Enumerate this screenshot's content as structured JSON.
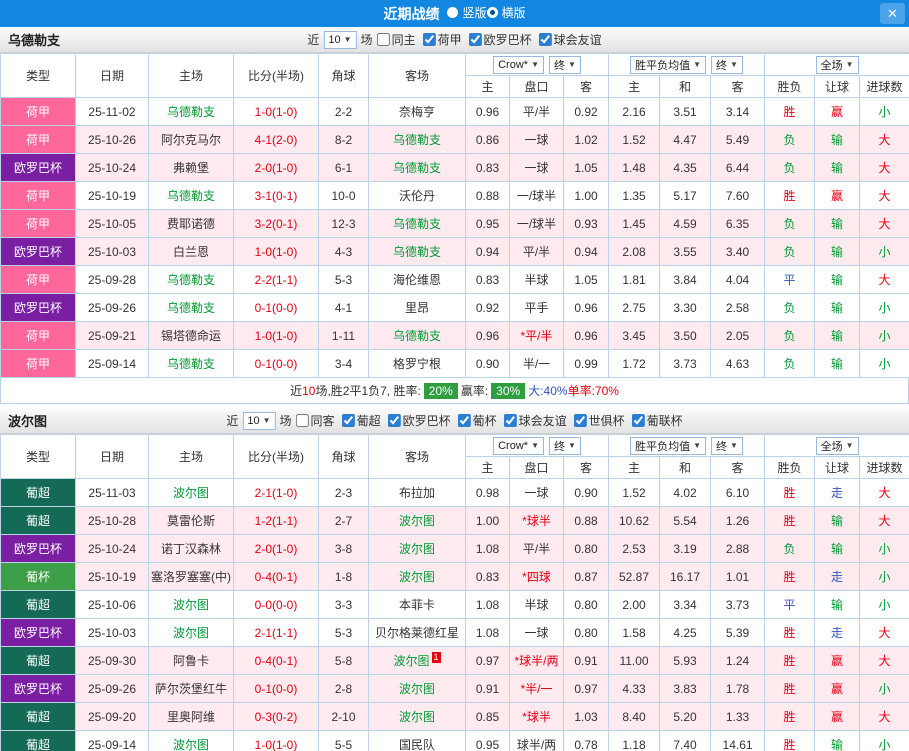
{
  "titlebar": {
    "title": "近期战绩",
    "options": [
      {
        "label": "竖版",
        "selected": false
      },
      {
        "label": "横版",
        "selected": true
      }
    ],
    "close": "✕"
  },
  "controls": {
    "recent_label": "近",
    "recent_count": "10",
    "games_label": "场"
  },
  "table_header": {
    "type": "类型",
    "date": "日期",
    "home": "主场",
    "score": "比分(半场)",
    "corner": "角球",
    "away": "客场",
    "odds_home": "主",
    "handicap": "盘口",
    "odds_away": "客",
    "win": "主",
    "draw": "和",
    "lose": "客",
    "wdl": "胜负",
    "ah": "让球",
    "ou": "进球数",
    "crow_select": "Crow*",
    "end_select": "终",
    "avg_select": "胜平负均值",
    "scope_select": "全场"
  },
  "colors": {
    "focal": "#009933",
    "score": "#e60012",
    "league": {
      "荷甲": "#ff6699",
      "欧罗巴杯": "#7b1fa2",
      "葡超": "#156a55",
      "葡杯": "#3c9e47"
    },
    "wdl": {
      "胜": "#e60012",
      "平": "#3355bb",
      "负": "#009933"
    },
    "ah": {
      "赢": "#e60012",
      "输": "#009933",
      "走": "#3355bb"
    },
    "ou": {
      "大": "#e60012",
      "小": "#009933"
    }
  },
  "sections": [
    {
      "team": "乌德勒支",
      "filters": [
        {
          "label": "同主",
          "checked": false
        },
        {
          "label": "荷甲",
          "checked": true
        },
        {
          "label": "欧罗巴杯",
          "checked": true
        },
        {
          "label": "球会友谊",
          "checked": true
        }
      ],
      "rows": [
        {
          "league": "荷甲",
          "date": "25-11-02",
          "home": "乌德勒支",
          "score": "1-0(1-0)",
          "corner": "2-2",
          "away": "奈梅亨",
          "o1": "0.96",
          "hc": "平/半",
          "o2": "0.92",
          "w": "2.16",
          "d": "3.51",
          "l": "3.14",
          "wdl": "胜",
          "ah": "赢",
          "ou": "小"
        },
        {
          "league": "荷甲",
          "date": "25-10-26",
          "home": "阿尔克马尔",
          "score": "4-1(2-0)",
          "corner": "8-2",
          "away": "乌德勒支",
          "o1": "0.86",
          "hc": "一球",
          "o2": "1.02",
          "w": "1.52",
          "d": "4.47",
          "l": "5.49",
          "wdl": "负",
          "ah": "输",
          "ou": "大"
        },
        {
          "league": "欧罗巴杯",
          "date": "25-10-24",
          "home": "弗赖堡",
          "score": "2-0(1-0)",
          "corner": "6-1",
          "away": "乌德勒支",
          "o1": "0.83",
          "hc": "一球",
          "o2": "1.05",
          "w": "1.48",
          "d": "4.35",
          "l": "6.44",
          "wdl": "负",
          "ah": "输",
          "ou": "大"
        },
        {
          "league": "荷甲",
          "date": "25-10-19",
          "home": "乌德勒支",
          "score": "3-1(0-1)",
          "corner": "10-0",
          "away": "沃伦丹",
          "o1": "0.88",
          "hc": "一/球半",
          "o2": "1.00",
          "w": "1.35",
          "d": "5.17",
          "l": "7.60",
          "wdl": "胜",
          "ah": "赢",
          "ou": "大"
        },
        {
          "league": "荷甲",
          "date": "25-10-05",
          "home": "费耶诺德",
          "score": "3-2(0-1)",
          "corner": "12-3",
          "away": "乌德勒支",
          "o1": "0.95",
          "hc": "一/球半",
          "o2": "0.93",
          "w": "1.45",
          "d": "4.59",
          "l": "6.35",
          "wdl": "负",
          "ah": "输",
          "ou": "大"
        },
        {
          "league": "欧罗巴杯",
          "date": "25-10-03",
          "home": "白兰恩",
          "score": "1-0(1-0)",
          "corner": "4-3",
          "away": "乌德勒支",
          "o1": "0.94",
          "hc": "平/半",
          "o2": "0.94",
          "w": "2.08",
          "d": "3.55",
          "l": "3.40",
          "wdl": "负",
          "ah": "输",
          "ou": "小"
        },
        {
          "league": "荷甲",
          "date": "25-09-28",
          "home": "乌德勒支",
          "score": "2-2(1-1)",
          "corner": "5-3",
          "away": "海伦维恩",
          "o1": "0.83",
          "hc": "半球",
          "o2": "1.05",
          "w": "1.81",
          "d": "3.84",
          "l": "4.04",
          "wdl": "平",
          "ah": "输",
          "ou": "大"
        },
        {
          "league": "欧罗巴杯",
          "date": "25-09-26",
          "home": "乌德勒支",
          "score": "0-1(0-0)",
          "corner": "4-1",
          "away": "里昂",
          "o1": "0.92",
          "hc": "平手",
          "o2": "0.96",
          "w": "2.75",
          "d": "3.30",
          "l": "2.58",
          "wdl": "负",
          "ah": "输",
          "ou": "小"
        },
        {
          "league": "荷甲",
          "date": "25-09-21",
          "home": "锡塔德命运",
          "score": "1-0(1-0)",
          "corner": "1-11",
          "away": "乌德勒支",
          "o1": "0.96",
          "hc": "*平/半",
          "o2": "0.96",
          "w": "3.45",
          "d": "3.50",
          "l": "2.05",
          "wdl": "负",
          "ah": "输",
          "ou": "小"
        },
        {
          "league": "荷甲",
          "date": "25-09-14",
          "home": "乌德勒支",
          "score": "0-1(0-0)",
          "corner": "3-4",
          "away": "格罗宁根",
          "o1": "0.90",
          "hc": "半/一",
          "o2": "0.99",
          "w": "1.72",
          "d": "3.73",
          "l": "4.63",
          "wdl": "负",
          "ah": "输",
          "ou": "小"
        }
      ],
      "summary": [
        {
          "text": "近",
          "color": "#333",
          "name": "summary-prefix"
        },
        {
          "text": "10",
          "color": "#e60012",
          "name": "summary-count"
        },
        {
          "text": "场,胜2平1负7, 胜率: ",
          "color": "#333",
          "name": "summary-record"
        },
        {
          "text": "20%",
          "badge": true,
          "name": "win-rate-badge"
        },
        {
          "text": " 赢率: ",
          "color": "#333",
          "name": "ah-rate-label"
        },
        {
          "text": "30%",
          "badge": true,
          "name": "ah-rate-badge"
        },
        {
          "text": " 大:40%",
          "color": "#3355bb",
          "name": "big-rate"
        },
        {
          "text": " 单率:70%",
          "color": "#e60012",
          "name": "single-rate"
        }
      ]
    },
    {
      "team": "波尔图",
      "filters": [
        {
          "label": "同客",
          "checked": false
        },
        {
          "label": "葡超",
          "checked": true
        },
        {
          "label": "欧罗巴杯",
          "checked": true
        },
        {
          "label": "葡杯",
          "checked": true
        },
        {
          "label": "球会友谊",
          "checked": true
        },
        {
          "label": "世俱杯",
          "checked": true
        },
        {
          "label": "葡联杯",
          "checked": true
        }
      ],
      "rows": [
        {
          "league": "葡超",
          "date": "25-11-03",
          "home": "波尔图",
          "score": "2-1(1-0)",
          "corner": "2-3",
          "away": "布拉加",
          "o1": "0.98",
          "hc": "一球",
          "o2": "0.90",
          "w": "1.52",
          "d": "4.02",
          "l": "6.10",
          "wdl": "胜",
          "ah": "走",
          "ou": "大"
        },
        {
          "league": "葡超",
          "date": "25-10-28",
          "home": "莫雷伦斯",
          "score": "1-2(1-1)",
          "corner": "2-7",
          "away": "波尔图",
          "o1": "1.00",
          "hc": "*球半",
          "o2": "0.88",
          "w": "10.62",
          "d": "5.54",
          "l": "1.26",
          "wdl": "胜",
          "ah": "输",
          "ou": "大"
        },
        {
          "league": "欧罗巴杯",
          "date": "25-10-24",
          "home": "诺丁汉森林",
          "score": "2-0(1-0)",
          "corner": "3-8",
          "away": "波尔图",
          "o1": "1.08",
          "hc": "平/半",
          "o2": "0.80",
          "w": "2.53",
          "d": "3.19",
          "l": "2.88",
          "wdl": "负",
          "ah": "输",
          "ou": "小"
        },
        {
          "league": "葡杯",
          "date": "25-10-19",
          "home": "塞洛罗塞塞(中)",
          "score": "0-4(0-1)",
          "corner": "1-8",
          "away": "波尔图",
          "o1": "0.83",
          "hc": "*四球",
          "o2": "0.87",
          "w": "52.87",
          "d": "16.17",
          "l": "1.01",
          "wdl": "胜",
          "ah": "走",
          "ou": "小"
        },
        {
          "league": "葡超",
          "date": "25-10-06",
          "home": "波尔图",
          "score": "0-0(0-0)",
          "corner": "3-3",
          "away": "本菲卡",
          "o1": "1.08",
          "hc": "半球",
          "o2": "0.80",
          "w": "2.00",
          "d": "3.34",
          "l": "3.73",
          "wdl": "平",
          "ah": "输",
          "ou": "小"
        },
        {
          "league": "欧罗巴杯",
          "date": "25-10-03",
          "home": "波尔图",
          "score": "2-1(1-1)",
          "corner": "5-3",
          "away": "贝尔格莱德红星",
          "o1": "1.08",
          "hc": "一球",
          "o2": "0.80",
          "w": "1.58",
          "d": "4.25",
          "l": "5.39",
          "wdl": "胜",
          "ah": "走",
          "ou": "大"
        },
        {
          "league": "葡超",
          "date": "25-09-30",
          "home": "阿鲁卡",
          "score": "0-4(0-1)",
          "corner": "5-8",
          "away": "波尔图",
          "away_sup": "1",
          "o1": "0.97",
          "hc": "*球半/两",
          "o2": "0.91",
          "w": "11.00",
          "d": "5.93",
          "l": "1.24",
          "wdl": "胜",
          "ah": "赢",
          "ou": "大"
        },
        {
          "league": "欧罗巴杯",
          "date": "25-09-26",
          "home": "萨尔茨堡红牛",
          "score": "0-1(0-0)",
          "corner": "2-8",
          "away": "波尔图",
          "o1": "0.91",
          "hc": "*半/一",
          "o2": "0.97",
          "w": "4.33",
          "d": "3.83",
          "l": "1.78",
          "wdl": "胜",
          "ah": "赢",
          "ou": "小"
        },
        {
          "league": "葡超",
          "date": "25-09-20",
          "home": "里奥阿维",
          "score": "0-3(0-2)",
          "corner": "2-10",
          "away": "波尔图",
          "o1": "0.85",
          "hc": "*球半",
          "o2": "1.03",
          "w": "8.40",
          "d": "5.20",
          "l": "1.33",
          "wdl": "胜",
          "ah": "赢",
          "ou": "大"
        },
        {
          "league": "葡超",
          "date": "25-09-14",
          "home": "波尔图",
          "score": "1-0(1-0)",
          "corner": "5-5",
          "away": "国民队",
          "o1": "0.95",
          "hc": "球半/两",
          "o2": "0.78",
          "w": "1.18",
          "d": "7.40",
          "l": "14.61",
          "wdl": "胜",
          "ah": "输",
          "ou": "小"
        }
      ]
    }
  ]
}
